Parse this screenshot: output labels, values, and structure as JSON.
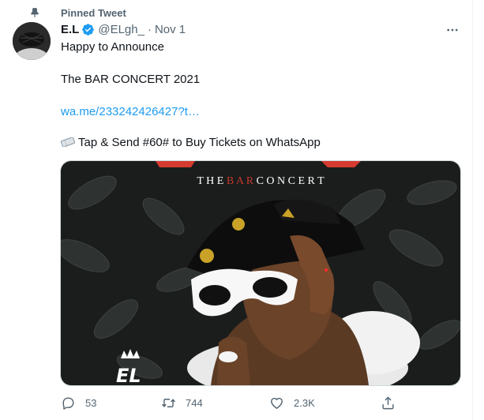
{
  "pinned": {
    "label": "Pinned Tweet"
  },
  "tweet": {
    "author_name": "E.L",
    "handle": "@ELgh_",
    "separator": "·",
    "date": "Nov 1",
    "line1": "Happy to Announce",
    "line2": "The BAR CONCERT 2021",
    "link": "wa.me/233242426427?t…",
    "line3": "Tap & Send #60# to Buy Tickets on WhatsApp"
  },
  "media": {
    "poster_title_pre": "T H E ",
    "poster_title_accent": "B A R",
    "poster_title_post": " C O N C E R T",
    "corner_logo": "EL"
  },
  "actions": {
    "replies": "53",
    "retweets": "744",
    "likes": "2.3K"
  },
  "colors": {
    "accent": "#1d9bf0",
    "secondary_text": "#536471",
    "poster_accent": "#c0392b",
    "poster_background": "#1b1d1c"
  },
  "icons": {
    "pin": "pin-icon",
    "verified": "verified-badge-icon",
    "more": "more-icon",
    "ticket": "ticket-icon",
    "reply": "reply-icon",
    "retweet": "retweet-icon",
    "like": "like-icon",
    "share": "share-icon"
  }
}
